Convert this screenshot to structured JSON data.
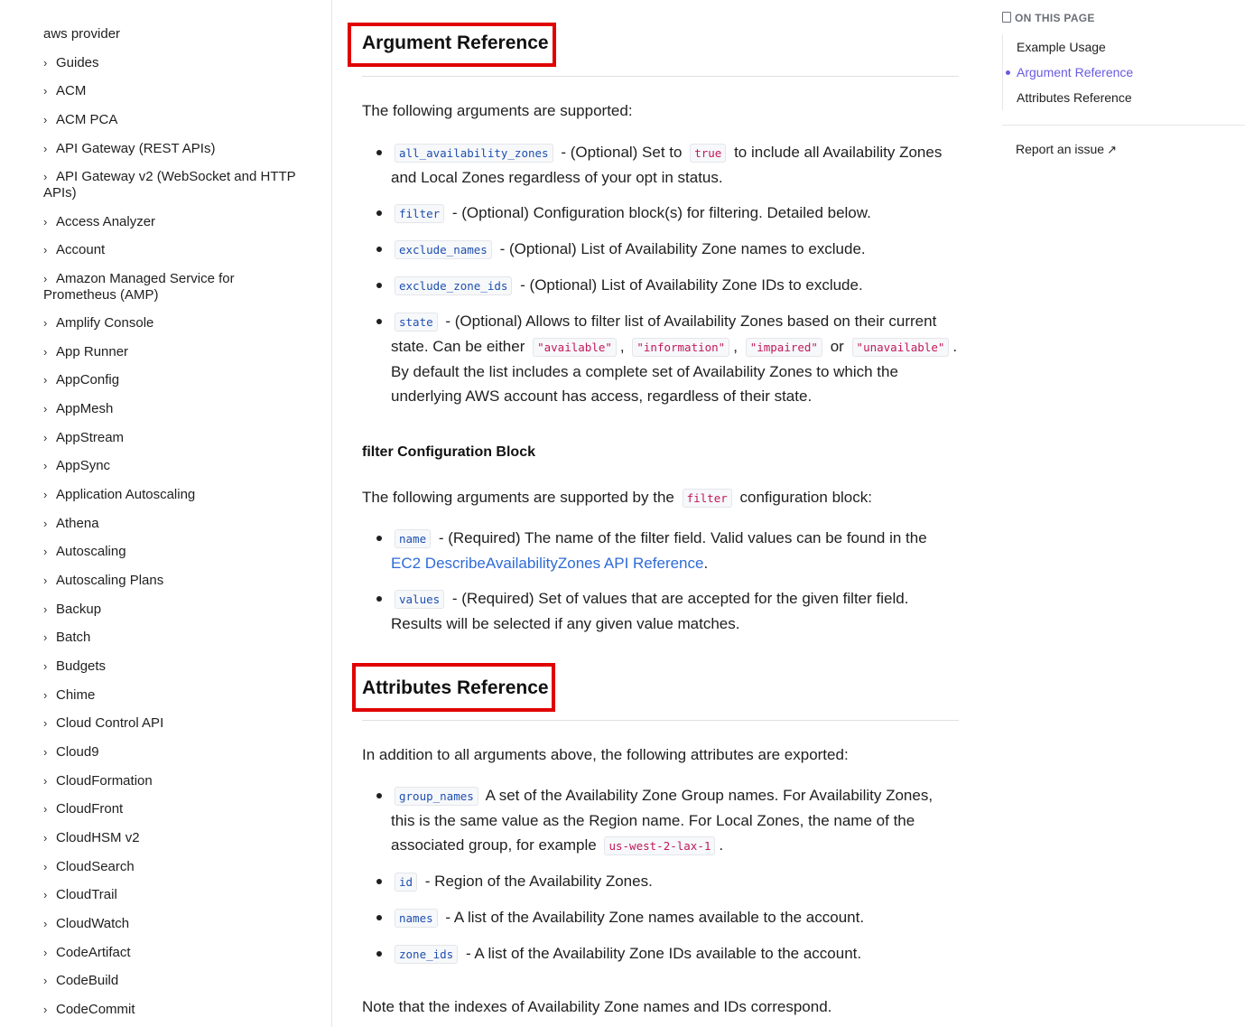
{
  "sidebar": {
    "root": "aws provider",
    "items": [
      "Guides",
      "ACM",
      "ACM PCA",
      "API Gateway (REST APIs)",
      "API Gateway v2 (WebSocket and HTTP APIs)",
      "Access Analyzer",
      "Account",
      "Amazon Managed Service for Prometheus (AMP)",
      "Amplify Console",
      "App Runner",
      "AppConfig",
      "AppMesh",
      "AppStream",
      "AppSync",
      "Application Autoscaling",
      "Athena",
      "Autoscaling",
      "Autoscaling Plans",
      "Backup",
      "Batch",
      "Budgets",
      "Chime",
      "Cloud Control API",
      "Cloud9",
      "CloudFormation",
      "CloudFront",
      "CloudHSM v2",
      "CloudSearch",
      "CloudTrail",
      "CloudWatch",
      "CodeArtifact",
      "CodeBuild",
      "CodeCommit"
    ]
  },
  "main": {
    "argument_heading": "Argument Reference",
    "argument_intro": "The following arguments are supported:",
    "args": {
      "a1_code": "all_availability_zones",
      "a1_text1": "- (Optional) Set to",
      "a1_val": "true",
      "a1_text2": "to include all Availability Zones and Local Zones regardless of your opt in status.",
      "a2_code": "filter",
      "a2_text": "- (Optional) Configuration block(s) for filtering. Detailed below.",
      "a3_code": "exclude_names",
      "a3_text": "- (Optional) List of Availability Zone names to exclude.",
      "a4_code": "exclude_zone_ids",
      "a4_text": "- (Optional) List of Availability Zone IDs to exclude.",
      "a5_code": "state",
      "a5_text1": "- (Optional) Allows to filter list of Availability Zones based on their current state. Can be either",
      "a5_v1": "\"available\"",
      "a5_comma1": ",",
      "a5_v2": "\"information\"",
      "a5_comma2": ",",
      "a5_v3": "\"impaired\"",
      "a5_or": "or",
      "a5_v4": "\"unavailable\"",
      "a5_text2": ". By default the list includes a complete set of Availability Zones to which the underlying AWS account has access, regardless of their state."
    },
    "filter_heading": "filter Configuration Block",
    "filter_intro1": "The following arguments are supported by the",
    "filter_intro_code": "filter",
    "filter_intro2": "configuration block:",
    "filter_args": {
      "f1_code": "name",
      "f1_text": "- (Required) The name of the filter field. Valid values can be found in the",
      "f1_link": "EC2 DescribeAvailabilityZones API Reference",
      "f1_end": ".",
      "f2_code": "values",
      "f2_text": "- (Required) Set of values that are accepted for the given filter field. Results will be selected if any given value matches."
    },
    "attributes_heading": "Attributes Reference",
    "attributes_intro": "In addition to all arguments above, the following attributes are exported:",
    "attrs": {
      "t1_code": "group_names",
      "t1_text": "A set of the Availability Zone Group names. For Availability Zones, this is the same value as the Region name. For Local Zones, the name of the associated group, for example",
      "t1_val": "us-west-2-lax-1",
      "t1_end": ".",
      "t2_code": "id",
      "t2_text": "- Region of the Availability Zones.",
      "t3_code": "names",
      "t3_text": "- A list of the Availability Zone names available to the account.",
      "t4_code": "zone_ids",
      "t4_text": "- A list of the Availability Zone IDs available to the account."
    },
    "note": "Note that the indexes of Availability Zone names and IDs correspond."
  },
  "toc": {
    "heading": "ON THIS PAGE",
    "items": [
      "Example Usage",
      "Argument Reference",
      "Attributes Reference"
    ],
    "active_index": 1,
    "report": "Report an issue",
    "report_icon": "external-link-icon"
  },
  "colors": {
    "highlight_box": "#e00000",
    "toc_active": "#6a5ae0",
    "link": "#2f6bd6",
    "code_arg": "#1d4fb0",
    "code_value": "#c2185b"
  }
}
